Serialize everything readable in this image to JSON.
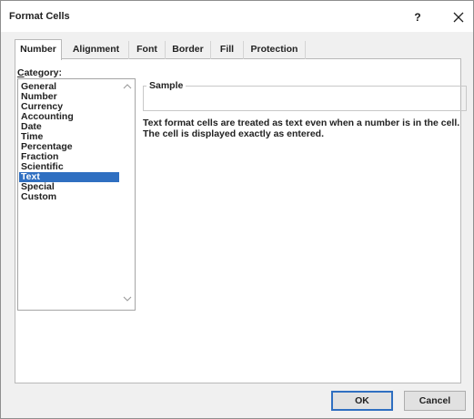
{
  "dialog": {
    "title": "Format Cells",
    "help_glyph": "?",
    "close_icon": "close-icon"
  },
  "tabs": [
    {
      "label": "Number",
      "active": true
    },
    {
      "label": "Alignment",
      "active": false
    },
    {
      "label": "Font",
      "active": false
    },
    {
      "label": "Border",
      "active": false
    },
    {
      "label": "Fill",
      "active": false
    },
    {
      "label": "Protection",
      "active": false
    }
  ],
  "category": {
    "label_accel": "C",
    "label_rest": "ategory:",
    "items": [
      "General",
      "Number",
      "Currency",
      "Accounting",
      "Date",
      "Time",
      "Percentage",
      "Fraction",
      "Scientific",
      "Text",
      "Special",
      "Custom"
    ],
    "selected": "Text"
  },
  "sample": {
    "label": "Sample"
  },
  "description": {
    "line1": "Text format cells are treated as text even when a number is in the cell.",
    "line2": "The cell is displayed exactly as entered."
  },
  "buttons": {
    "ok": "OK",
    "cancel": "Cancel"
  },
  "colors": {
    "selection": "#2f6fc1",
    "dialog_bg": "#f0f0f0"
  }
}
